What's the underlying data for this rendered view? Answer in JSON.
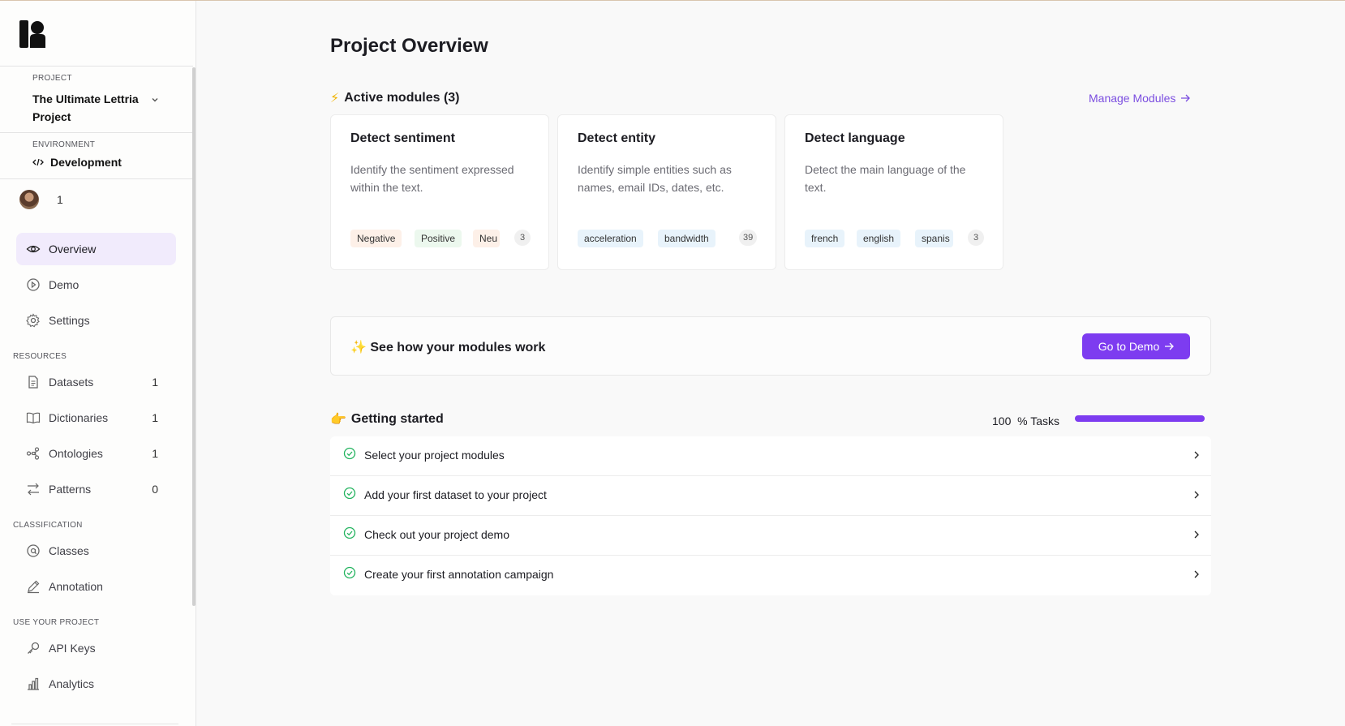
{
  "sidebar": {
    "project_caption": "PROJECT",
    "project_name": "The Ultimate Lettria Project",
    "environment_caption": "ENVIRONMENT",
    "environment_name": "Development",
    "member_count": "1",
    "nav": [
      {
        "label": "Overview",
        "icon": "eye-icon",
        "active": true
      },
      {
        "label": "Demo",
        "icon": "play-icon"
      },
      {
        "label": "Settings",
        "icon": "gear-icon"
      }
    ],
    "resources_caption": "RESOURCES",
    "resources": [
      {
        "label": "Datasets",
        "count": "1",
        "icon": "file-icon"
      },
      {
        "label": "Dictionaries",
        "count": "1",
        "icon": "book-icon"
      },
      {
        "label": "Ontologies",
        "count": "1",
        "icon": "graph-icon"
      },
      {
        "label": "Patterns",
        "count": "0",
        "icon": "flow-icon"
      }
    ],
    "classification_caption": "CLASSIFICATION",
    "classification": [
      {
        "label": "Classes",
        "icon": "at-icon"
      },
      {
        "label": "Annotation",
        "icon": "pencil-icon"
      }
    ],
    "use_caption": "USE YOUR PROJECT",
    "use": [
      {
        "label": "API Keys",
        "icon": "key-icon"
      },
      {
        "label": "Analytics",
        "icon": "bar-chart-icon"
      }
    ]
  },
  "main": {
    "title": "Project Overview",
    "active_modules_emoji": "⚡",
    "active_modules_title": "Active modules (3)",
    "manage_link": "Manage Modules",
    "modules": [
      {
        "title": "Detect sentiment",
        "description": "Identify the sentiment expressed within the text.",
        "tags": [
          "Negative",
          "Positive",
          "Neu"
        ],
        "more": "3"
      },
      {
        "title": "Detect entity",
        "description": "Identify simple entities such as names, email IDs, dates, etc.",
        "tags": [
          "acceleration",
          "bandwidth"
        ],
        "more": "39"
      },
      {
        "title": "Detect language",
        "description": "Detect the main language of the text.",
        "tags": [
          "french",
          "english",
          "spanis"
        ],
        "more": "3"
      }
    ],
    "demo": {
      "emoji": "✨",
      "text": "See how your modules work",
      "button": "Go to Demo"
    },
    "getting_started": {
      "emoji": "👉",
      "title": "Getting started",
      "progress_value": "100",
      "progress_unit": "% Tasks",
      "progress_fraction": 1.0,
      "tasks": [
        "Select your project modules",
        "Add your first dataset to your project",
        "Check out your project demo",
        "Create your first annotation campaign"
      ]
    }
  },
  "colors": {
    "accent": "#7d3cf0",
    "active_nav_bg": "#f1ebfc",
    "check_green": "#22b35e"
  }
}
